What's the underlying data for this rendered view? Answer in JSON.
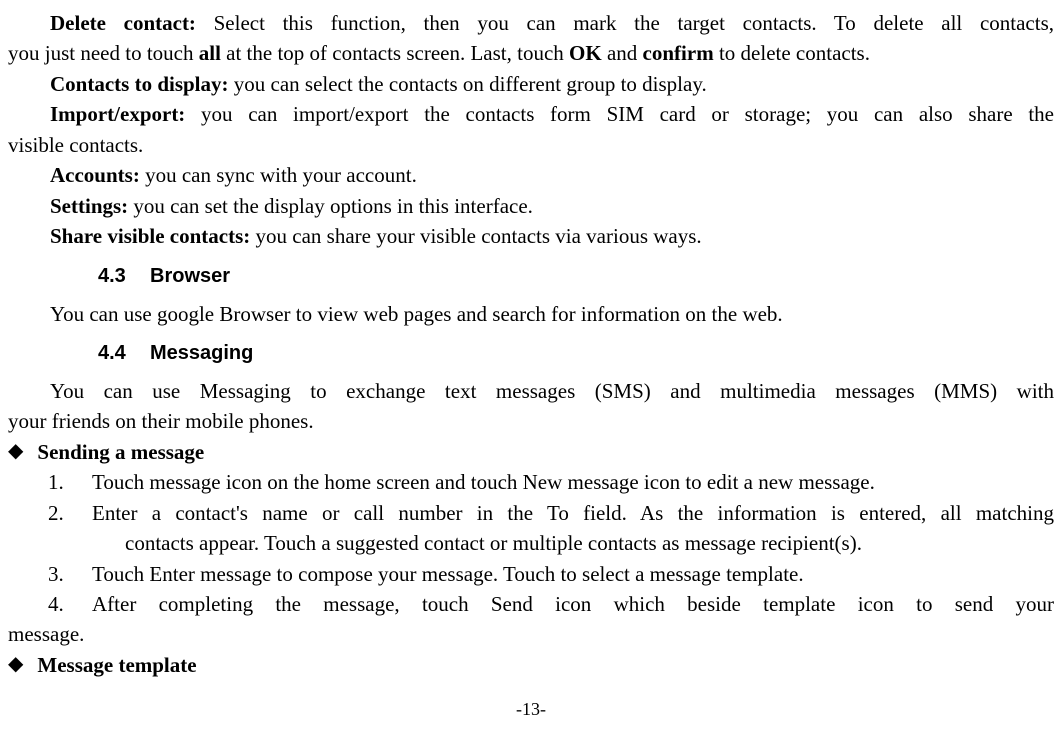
{
  "p1": {
    "b1": "Delete contact:",
    "t1a": " Select this function, then you can mark the target contacts. To delete all contacts,",
    "t1b": "you just need to touch ",
    "b2": "all",
    "t1c": " at the top of contacts screen. Last, touch ",
    "b3": "OK",
    "t1d": " and ",
    "b4": "confirm",
    "t1e": " to delete contacts."
  },
  "p2": {
    "b": "Contacts to display:",
    "t": " you can select the contacts on different group to display."
  },
  "p3": {
    "b": "Import/export:",
    "ta": " you can import/export the contacts form SIM card or storage; you can also share the",
    "tb": "visible contacts."
  },
  "p4": {
    "b": "Accounts:",
    "t": " you can sync with your account."
  },
  "p5": {
    "b": "Settings:",
    "t": " you can set the display options in this interface."
  },
  "p6": {
    "b": "Share visible contacts:",
    "t": " you can share your visible contacts via various ways."
  },
  "h1": {
    "num": "4.3",
    "title": "Browser"
  },
  "p7": "You can use google Browser to view web pages and search for information on the web.",
  "h2": {
    "num": "4.4",
    "title": "Messaging"
  },
  "p8a": "You can use Messaging to exchange text messages (SMS) and multimedia messages (MMS) with",
  "p8b": "your friends on their mobile phones.",
  "bullet1": "Sending a message",
  "n1": {
    "num": "1.",
    "t": "Touch message icon on the home screen and touch New message icon to edit a new message."
  },
  "n2": {
    "num": "2.",
    "ta": "Enter a contact's name or call number in the To field. As the information is entered, all matching",
    "tb": "contacts appear. Touch a suggested contact or multiple contacts as message recipient(s)."
  },
  "n3": {
    "num": "3.",
    "t": "Touch Enter message to compose your message. Touch to select a message template."
  },
  "n4": {
    "num": "4.",
    "ta": " After completing the message, touch Send icon which beside template icon to send your",
    "tb": "message."
  },
  "bullet2": "Message template",
  "pagenum": "-13-"
}
